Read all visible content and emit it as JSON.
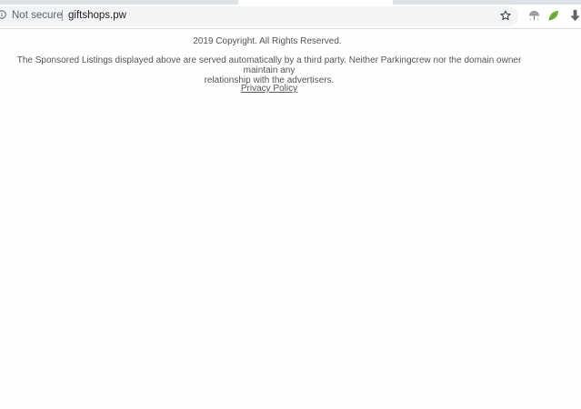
{
  "browser": {
    "security_label": "Not secure",
    "url": "giftshops.pw",
    "icons": [
      "info-icon",
      "bookmark-star-icon",
      "weather-extension-icon",
      "leaf-extension-icon",
      "download-extension-icon"
    ],
    "colors": {
      "tabstrip": "#dee1e6",
      "omnibox": "#f1f3f4",
      "leaf": "#7cb342"
    }
  },
  "page": {
    "copyright": "2019 Copyright. All Rights Reserved.",
    "disclaimer_line1": "The Sponsored Listings displayed above are served automatically by a third party. Neither Parkingcrew nor the domain owner maintain any",
    "disclaimer_line2": "relationship with the advertisers.",
    "privacy_link": "Privacy Policy",
    "text_color": "#555555"
  }
}
